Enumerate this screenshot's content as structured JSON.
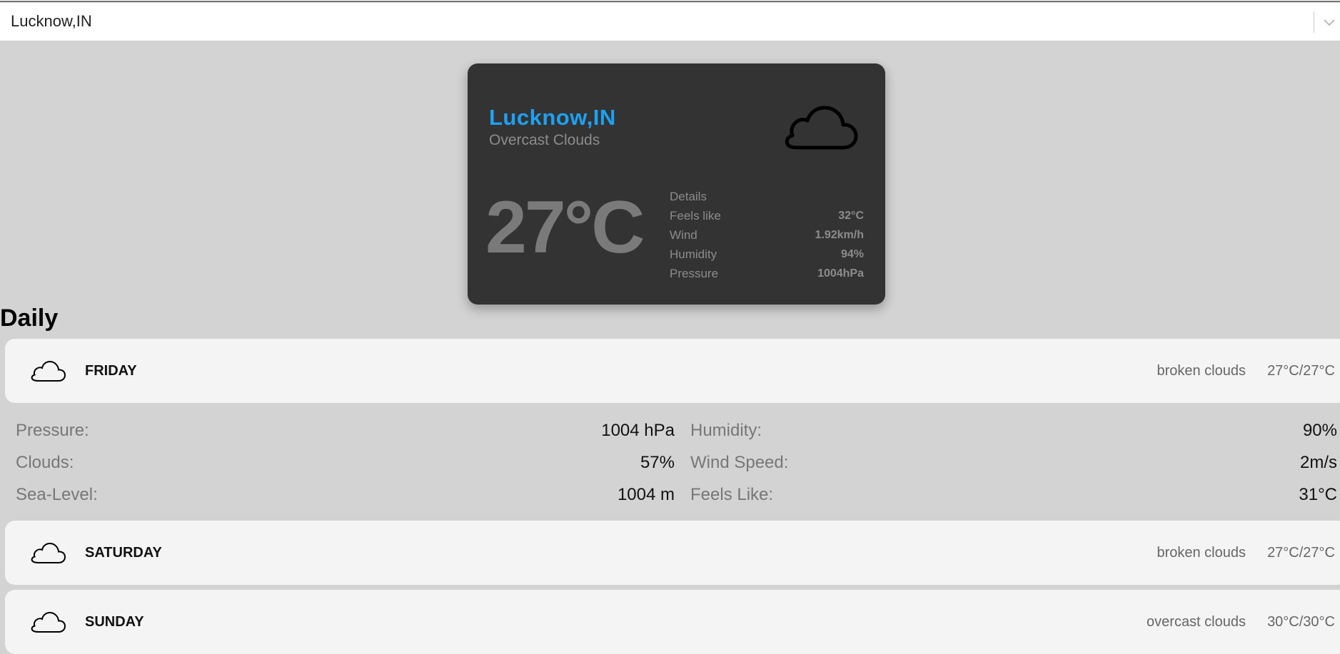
{
  "search": {
    "value": "Lucknow,IN"
  },
  "current": {
    "city": "Lucknow,IN",
    "description": "Overcast Clouds",
    "temperature": "27°C",
    "icon": "cloud-icon",
    "details_heading": "Details",
    "details": [
      {
        "label": "Feels like",
        "value": "32°C"
      },
      {
        "label": "Wind",
        "value": "1.92km/h"
      },
      {
        "label": "Humidity",
        "value": "94%"
      },
      {
        "label": "Pressure",
        "value": "1004hPa"
      }
    ]
  },
  "daily": {
    "heading": "Daily",
    "days": [
      {
        "name": "FRIDAY",
        "description": "broken clouds",
        "minmax": "27°C/27°C",
        "icon": "cloud-icon"
      },
      {
        "name": "SATURDAY",
        "description": "broken clouds",
        "minmax": "27°C/27°C",
        "icon": "cloud-icon"
      },
      {
        "name": "SUNDAY",
        "description": "overcast clouds",
        "minmax": "30°C/30°C",
        "icon": "cloud-icon"
      }
    ],
    "expanded": {
      "rows": [
        {
          "l1": "Pressure:",
          "v1": "1004 hPa",
          "l2": "Humidity:",
          "v2": "90%"
        },
        {
          "l1": "Clouds:",
          "v1": "57%",
          "l2": "Wind Speed:",
          "v2": "2m/s"
        },
        {
          "l1": "Sea-Level:",
          "v1": "1004 m",
          "l2": "Feels Like:",
          "v2": "31°C"
        }
      ]
    }
  },
  "colors": {
    "accent": "#1da1f2",
    "background": "#d3d3d3",
    "card": "#333333",
    "row": "#f4f4f4"
  }
}
